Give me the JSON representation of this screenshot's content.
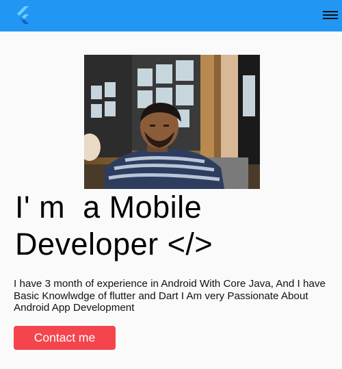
{
  "appbar": {
    "color": "#2196f3",
    "logo_icon": "flutter-logo-icon",
    "menu_icon": "hamburger-menu-icon"
  },
  "profile": {
    "photo_description": "profile-photo"
  },
  "hero": {
    "headline": "I' m  a Mobile\nDeveloper </>",
    "bio": "I have 3 month of  experience in  Android With Core Java,  And I have Basic Knowlwdge of flutter and Dart I Am very Passionate About Android App Development"
  },
  "actions": {
    "contact_label": "Contact me",
    "contact_color": "#f4454d"
  }
}
